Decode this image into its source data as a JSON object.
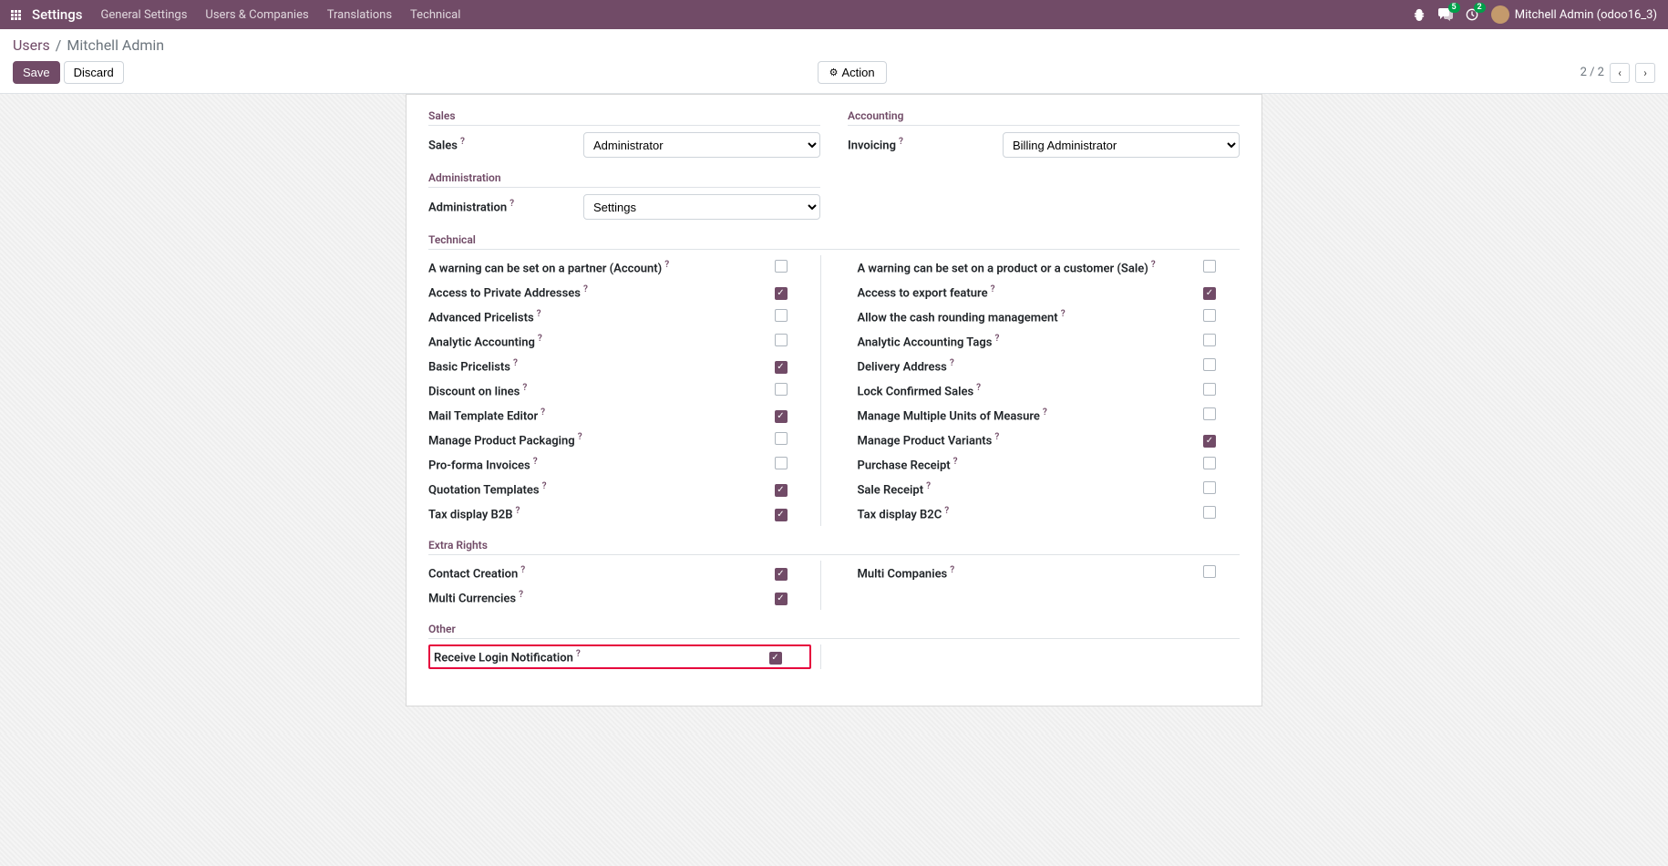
{
  "navbar": {
    "brand": "Settings",
    "items": [
      "General Settings",
      "Users & Companies",
      "Translations",
      "Technical"
    ],
    "messages_badge": "5",
    "activities_badge": "2",
    "user": "Mitchell Admin (odoo16_3)"
  },
  "breadcrumb": {
    "root": "Users",
    "current": "Mitchell Admin"
  },
  "buttons": {
    "save": "Save",
    "discard": "Discard",
    "action": "Action"
  },
  "pager": {
    "text": "2 / 2"
  },
  "sections": {
    "sales": {
      "title": "Sales",
      "field_label": "Sales",
      "value": "Administrator"
    },
    "accounting": {
      "title": "Accounting",
      "field_label": "Invoicing",
      "value": "Billing Administrator"
    },
    "administration": {
      "title": "Administration",
      "field_label": "Administration",
      "value": "Settings"
    },
    "technical": {
      "title": "Technical"
    },
    "extra": {
      "title": "Extra Rights"
    },
    "other": {
      "title": "Other"
    }
  },
  "technical_left": [
    {
      "label": "A warning can be set on a partner (Account)",
      "checked": false
    },
    {
      "label": "Access to Private Addresses",
      "checked": true
    },
    {
      "label": "Advanced Pricelists",
      "checked": false
    },
    {
      "label": "Analytic Accounting",
      "checked": false
    },
    {
      "label": "Basic Pricelists",
      "checked": true
    },
    {
      "label": "Discount on lines",
      "checked": false
    },
    {
      "label": "Mail Template Editor",
      "checked": true
    },
    {
      "label": "Manage Product Packaging",
      "checked": false
    },
    {
      "label": "Pro-forma Invoices",
      "checked": false
    },
    {
      "label": "Quotation Templates",
      "checked": true
    },
    {
      "label": "Tax display B2B",
      "checked": true
    }
  ],
  "technical_right": [
    {
      "label": "A warning can be set on a product or a customer (Sale)",
      "checked": false
    },
    {
      "label": "Access to export feature",
      "checked": true
    },
    {
      "label": "Allow the cash rounding management",
      "checked": false
    },
    {
      "label": "Analytic Accounting Tags",
      "checked": false
    },
    {
      "label": "Delivery Address",
      "checked": false
    },
    {
      "label": "Lock Confirmed Sales",
      "checked": false
    },
    {
      "label": "Manage Multiple Units of Measure",
      "checked": false
    },
    {
      "label": "Manage Product Variants",
      "checked": true
    },
    {
      "label": "Purchase Receipt",
      "checked": false
    },
    {
      "label": "Sale Receipt",
      "checked": false
    },
    {
      "label": "Tax display B2C",
      "checked": false
    }
  ],
  "extra_left": [
    {
      "label": "Contact Creation",
      "checked": true
    },
    {
      "label": "Multi Currencies",
      "checked": true
    }
  ],
  "extra_right": [
    {
      "label": "Multi Companies",
      "checked": false
    }
  ],
  "other_left": [
    {
      "label": "Receive Login Notification",
      "checked": true,
      "highlight": true
    }
  ]
}
